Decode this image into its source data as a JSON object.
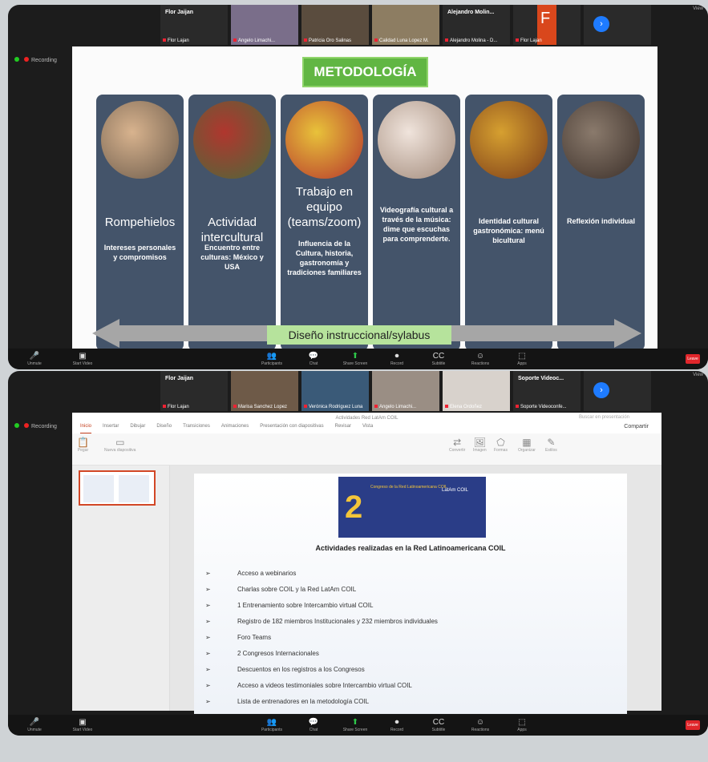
{
  "meeting1": {
    "gallery": [
      {
        "label": "Flor Jaijan",
        "name": "Flor Lajan",
        "kind": "name"
      },
      {
        "label": "",
        "name": "Angelo Limachi...",
        "kind": "video",
        "bg": "#7a6e8a"
      },
      {
        "label": "",
        "name": "Patricia Oro Salinas",
        "kind": "video",
        "bg": "#5a4c3e"
      },
      {
        "label": "",
        "name": "Calidad Luna Lopez M.",
        "kind": "video",
        "bg": "#8d7d62"
      },
      {
        "label": "Alejandro Molin...",
        "name": "Alejandro Molina - D...",
        "kind": "name"
      },
      {
        "label": "F",
        "name": "Flor Lajan",
        "kind": "letter"
      },
      {
        "label": "",
        "name": "",
        "kind": "next"
      }
    ],
    "recording": "Recording",
    "corner": "View"
  },
  "slide1": {
    "heading": "METODOLOGÍA",
    "cards": [
      {
        "title": "Rompehielos",
        "sub": "Intereses personales y compromisos",
        "photo": [
          "#d8b38e",
          "#6b5a4a"
        ]
      },
      {
        "title": "Actividad intercultural",
        "sub": "Encuentro entre culturas: México y USA",
        "photo": [
          "#b0362e",
          "#4a6b3a"
        ]
      },
      {
        "title": "Trabajo en equipo (teams/zoom)",
        "sub": "Influencia de la Cultura, historia, gastronomía y tradiciones familiares",
        "photo": [
          "#e8c23a",
          "#b5342c"
        ]
      },
      {
        "title": "",
        "sub": "Videografía cultural a través de la música: dime que escuchas para comprenderte.",
        "photo": [
          "#f0e4dc",
          "#a08878"
        ]
      },
      {
        "title": "",
        "sub": "Identidad cultural gastronómica: menú bicultural",
        "photo": [
          "#d6a030",
          "#7a3a18"
        ]
      },
      {
        "title": "",
        "sub": "Reflexión individual",
        "photo": [
          "#8a7a6c",
          "#3a2e28"
        ]
      }
    ],
    "arrow_label": "Diseño instruccional/sylabus"
  },
  "toolbar": {
    "left": [
      {
        "icon": "🎤",
        "label": "Unmute"
      },
      {
        "icon": "▣",
        "label": "Start Video"
      }
    ],
    "center": [
      {
        "icon": "👥",
        "label": "Participants"
      },
      {
        "icon": "💬",
        "label": "Chat"
      },
      {
        "icon": "⬆",
        "label": "Share Screen"
      },
      {
        "icon": "⏺",
        "label": "Record"
      },
      {
        "icon": "CC",
        "label": "Subtitle"
      },
      {
        "icon": "☺",
        "label": "Reactions"
      },
      {
        "icon": "⬚",
        "label": "Apps"
      }
    ],
    "end": "Leave"
  },
  "meeting2": {
    "gallery": [
      {
        "label": "Flor Jaijan",
        "name": "Flor Lajan",
        "kind": "name"
      },
      {
        "label": "",
        "name": "Marisa Sanchez Lopez",
        "kind": "video",
        "bg": "#6e5a48"
      },
      {
        "label": "",
        "name": "Verónica Rodriguez Luna",
        "kind": "video",
        "bg": "#3a5a78"
      },
      {
        "label": "",
        "name": "Angelo Limachi...",
        "kind": "video",
        "bg": "#9a8e84"
      },
      {
        "label": "",
        "name": "Elena Ordoñez",
        "kind": "video",
        "bg": "#d8d2cc"
      },
      {
        "label": "Soporte Videoc...",
        "name": "Soporte Videoconfe...",
        "kind": "name"
      },
      {
        "label": "",
        "name": "",
        "kind": "next"
      }
    ],
    "recording": "Recording",
    "corner": "View"
  },
  "ppt": {
    "title": "Actividades Red LatAm COIL",
    "search": "Buscar en presentación",
    "tabs": [
      "Inicio",
      "Insertar",
      "Dibujar",
      "Diseño",
      "Transiciones",
      "Animaciones",
      "Presentación con diapositivas",
      "Revisar",
      "Vista"
    ],
    "share": "Compartir",
    "ribbon": [
      "Pegar",
      "Nueva diapositiva",
      "Convertir",
      "Imagen",
      "Formas",
      "Organizar",
      "Estilos"
    ]
  },
  "slide2": {
    "banner_number": "2",
    "banner_text": "Congreso de la Red Latinoamericana COIL",
    "banner_logo": "LatAm COIL",
    "title": "Actividades realizadas en la Red Latinoamericana COIL",
    "bullet_marker": "➢",
    "bullets": [
      "Acceso a webinarios",
      "Charlas sobre COIL y la Red LatAm COIL",
      "1 Entrenamiento sobre Intercambio virtual COIL",
      "Registro de 182 miembros Institucionales y 232 miembros individuales",
      "Foro Teams",
      "2 Congresos Internacionales",
      "Descuentos en los registros a los Congresos",
      "Acceso a videos testimoniales sobre Intercambio virtual COIL",
      "Lista de entrenadores en la metodología COIL"
    ]
  }
}
